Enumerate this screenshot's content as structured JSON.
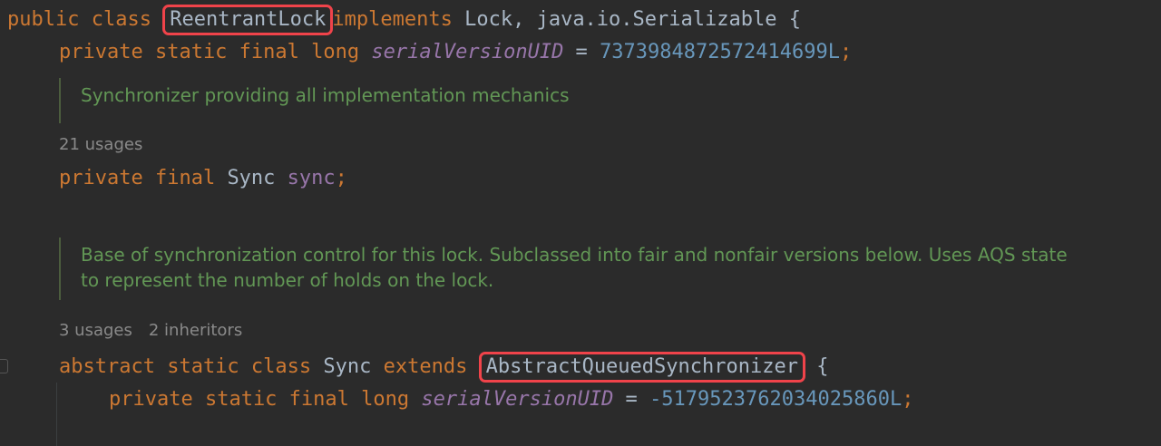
{
  "code": {
    "line1": {
      "kw_public": "public",
      "kw_class": "class",
      "class_name": "ReentrantLock",
      "kw_implements": "implements",
      "interfaces": "Lock, java.io.Serializable {"
    },
    "line2": {
      "mods": "private static final long",
      "field": "serialVersionUID",
      "eq": " = ",
      "value": "7373984872572414699L",
      "semi": ";"
    },
    "doc1": "Synchronizer providing all implementation mechanics",
    "hint1": {
      "usages": "21 usages"
    },
    "line3": {
      "mods": "private final",
      "type": "Sync",
      "field": "sync",
      "semi": ";"
    },
    "doc2": "Base of synchronization control for this lock. Subclassed into fair and nonfair versions below. Uses AQS state to represent the number of holds on the lock.",
    "hint2": {
      "usages": "3 usages",
      "inheritors": "2 inheritors"
    },
    "line4": {
      "mods": "abstract static class",
      "name": "Sync",
      "kw_extends": "extends",
      "super": "AbstractQueuedSynchronizer",
      "brace": " {"
    },
    "line5": {
      "mods": "private static final long",
      "field": "serialVersionUID",
      "eq": " = ",
      "value": "-5179523762034025860L",
      "semi": ";"
    }
  },
  "colors": {
    "background": "#2b2b2b",
    "keyword": "#cc7832",
    "field": "#9876aa",
    "number": "#6897bb",
    "doc_comment": "#629755",
    "highlight_border": "#f0434a"
  }
}
